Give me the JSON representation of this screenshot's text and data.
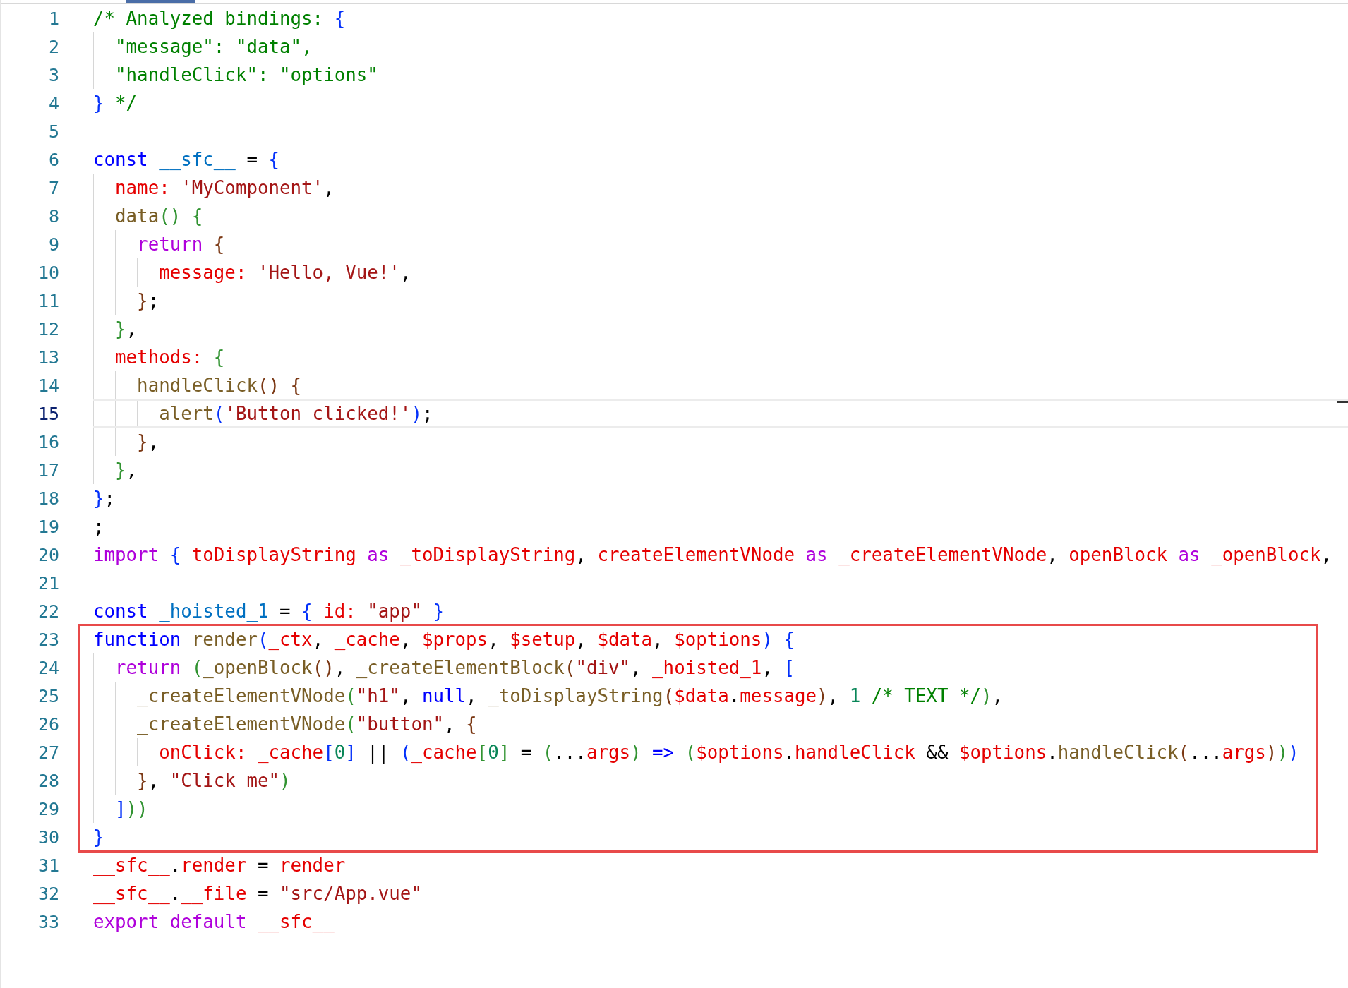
{
  "blocks": [
    {
      "boxed": false,
      "lines": [
        {
          "number": "1",
          "current": false,
          "tokens": [
            {
              "text": "/* Analyzed bindings: ",
              "kind": "comment"
            },
            {
              "text": "{",
              "kind": "b1"
            }
          ]
        },
        {
          "number": "2",
          "current": false,
          "tokens": [
            {
              "text": "  \"message\": \"data\",",
              "kind": "comment"
            }
          ]
        },
        {
          "number": "3",
          "current": false,
          "tokens": [
            {
              "text": "  \"handleClick\": \"options\"",
              "kind": "comment"
            }
          ]
        },
        {
          "number": "4",
          "current": false,
          "tokens": [
            {
              "text": "}",
              "kind": "b1"
            },
            {
              "text": " */",
              "kind": "comment"
            }
          ]
        },
        {
          "number": "5",
          "current": false
        },
        {
          "number": "6",
          "current": false,
          "tokens": [
            {
              "text": "const ",
              "kind": "keyword"
            },
            {
              "text": "__sfc__",
              "kind": "constant"
            },
            {
              "text": " = ",
              "kind": "punct"
            },
            {
              "text": "{",
              "kind": "b1"
            }
          ]
        },
        {
          "number": "7",
          "current": false,
          "tokens": [
            {
              "text": "  name: ",
              "kind": "variable"
            },
            {
              "text": "'MyComponent'",
              "kind": "string"
            },
            {
              "text": ",",
              "kind": "punct"
            }
          ]
        },
        {
          "number": "8",
          "current": false,
          "tokens": [
            {
              "text": "  data",
              "kind": "function"
            },
            {
              "text": "() {",
              "kind": "b2"
            }
          ]
        },
        {
          "number": "9",
          "current": false,
          "tokens": [
            {
              "text": "    return ",
              "kind": "control"
            },
            {
              "text": "{",
              "kind": "b3"
            }
          ]
        },
        {
          "number": "10",
          "current": false,
          "tokens": [
            {
              "text": "      message: ",
              "kind": "variable"
            },
            {
              "text": "'Hello, Vue!'",
              "kind": "string"
            },
            {
              "text": ",",
              "kind": "punct"
            }
          ]
        },
        {
          "number": "11",
          "current": false,
          "tokens": [
            {
              "text": "    }",
              "kind": "b3"
            },
            {
              "text": ";",
              "kind": "punct"
            }
          ]
        },
        {
          "number": "12",
          "current": false,
          "tokens": [
            {
              "text": "  }",
              "kind": "b2"
            },
            {
              "text": ",",
              "kind": "punct"
            }
          ]
        },
        {
          "number": "13",
          "current": false,
          "tokens": [
            {
              "text": "  methods: ",
              "kind": "variable"
            },
            {
              "text": "{",
              "kind": "b2"
            }
          ]
        },
        {
          "number": "14",
          "current": false,
          "tokens": [
            {
              "text": "    handleClick",
              "kind": "function"
            },
            {
              "text": "() {",
              "kind": "b3"
            }
          ]
        },
        {
          "number": "15",
          "current": true,
          "tokens": [
            {
              "text": "      alert",
              "kind": "function"
            },
            {
              "text": "(",
              "kind": "b1"
            },
            {
              "text": "'Button clicked!'",
              "kind": "string"
            },
            {
              "text": ")",
              "kind": "b1"
            },
            {
              "text": ";",
              "kind": "punct"
            }
          ]
        },
        {
          "number": "16",
          "current": false,
          "tokens": [
            {
              "text": "    }",
              "kind": "b3"
            },
            {
              "text": ",",
              "kind": "punct"
            }
          ]
        },
        {
          "number": "17",
          "current": false,
          "tokens": [
            {
              "text": "  }",
              "kind": "b2"
            },
            {
              "text": ",",
              "kind": "punct"
            }
          ]
        },
        {
          "number": "18",
          "current": false,
          "tokens": [
            {
              "text": "}",
              "kind": "b1"
            },
            {
              "text": ";",
              "kind": "punct"
            }
          ]
        },
        {
          "number": "19",
          "current": false,
          "tokens": [
            {
              "text": ";",
              "kind": "punct"
            }
          ]
        },
        {
          "number": "20",
          "current": false,
          "tokens": [
            {
              "text": "import ",
              "kind": "control"
            },
            {
              "text": "{ ",
              "kind": "b1"
            },
            {
              "text": "toDisplayString ",
              "kind": "variable"
            },
            {
              "text": "as ",
              "kind": "control"
            },
            {
              "text": "_toDisplayString",
              "kind": "variable"
            },
            {
              "text": ", ",
              "kind": "punct"
            },
            {
              "text": "createElementVNode ",
              "kind": "variable"
            },
            {
              "text": "as ",
              "kind": "control"
            },
            {
              "text": "_createElementVNode",
              "kind": "variable"
            },
            {
              "text": ", ",
              "kind": "punct"
            },
            {
              "text": "openBlock ",
              "kind": "variable"
            },
            {
              "text": "as ",
              "kind": "control"
            },
            {
              "text": "_openBlock",
              "kind": "variable"
            },
            {
              "text": ",",
              "kind": "punct"
            }
          ]
        },
        {
          "number": "21",
          "current": false
        },
        {
          "number": "22",
          "current": false,
          "tokens": [
            {
              "text": "const ",
              "kind": "keyword"
            },
            {
              "text": "_hoisted_1",
              "kind": "constant"
            },
            {
              "text": " = ",
              "kind": "punct"
            },
            {
              "text": "{ ",
              "kind": "b1"
            },
            {
              "text": "id: ",
              "kind": "variable"
            },
            {
              "text": "\"app\"",
              "kind": "string"
            },
            {
              "text": " }",
              "kind": "b1"
            }
          ]
        }
      ]
    },
    {
      "boxed": true,
      "lines": [
        {
          "number": "23",
          "current": false,
          "tokens": [
            {
              "text": "function ",
              "kind": "keyword"
            },
            {
              "text": "render",
              "kind": "function"
            },
            {
              "text": "(",
              "kind": "b1"
            },
            {
              "text": "_ctx",
              "kind": "variable"
            },
            {
              "text": ", ",
              "kind": "punct"
            },
            {
              "text": "_cache",
              "kind": "variable"
            },
            {
              "text": ", ",
              "kind": "punct"
            },
            {
              "text": "$props",
              "kind": "variable"
            },
            {
              "text": ", ",
              "kind": "punct"
            },
            {
              "text": "$setup",
              "kind": "variable"
            },
            {
              "text": ", ",
              "kind": "punct"
            },
            {
              "text": "$data",
              "kind": "variable"
            },
            {
              "text": ", ",
              "kind": "punct"
            },
            {
              "text": "$options",
              "kind": "variable"
            },
            {
              "text": ") {",
              "kind": "b1"
            }
          ]
        },
        {
          "number": "24",
          "current": false,
          "tokens": [
            {
              "text": "  return ",
              "kind": "control"
            },
            {
              "text": "(",
              "kind": "b2"
            },
            {
              "text": "_openBlock",
              "kind": "function"
            },
            {
              "text": "()",
              "kind": "b3"
            },
            {
              "text": ", ",
              "kind": "punct"
            },
            {
              "text": "_createElementBlock",
              "kind": "function"
            },
            {
              "text": "(",
              "kind": "b3"
            },
            {
              "text": "\"div\"",
              "kind": "string"
            },
            {
              "text": ", ",
              "kind": "punct"
            },
            {
              "text": "_hoisted_1",
              "kind": "variable"
            },
            {
              "text": ", ",
              "kind": "punct"
            },
            {
              "text": "[",
              "kind": "b1"
            }
          ]
        },
        {
          "number": "25",
          "current": false,
          "tokens": [
            {
              "text": "    _createElementVNode",
              "kind": "function"
            },
            {
              "text": "(",
              "kind": "b2"
            },
            {
              "text": "\"h1\"",
              "kind": "string"
            },
            {
              "text": ", ",
              "kind": "punct"
            },
            {
              "text": "null",
              "kind": "keyword"
            },
            {
              "text": ", ",
              "kind": "punct"
            },
            {
              "text": "_toDisplayString",
              "kind": "function"
            },
            {
              "text": "(",
              "kind": "b3"
            },
            {
              "text": "$data",
              "kind": "variable"
            },
            {
              "text": ".",
              "kind": "punct"
            },
            {
              "text": "message",
              "kind": "variable"
            },
            {
              "text": ")",
              "kind": "b3"
            },
            {
              "text": ", ",
              "kind": "punct"
            },
            {
              "text": "1 ",
              "kind": "number"
            },
            {
              "text": "/* TEXT */",
              "kind": "comment"
            },
            {
              "text": ")",
              "kind": "b2"
            },
            {
              "text": ",",
              "kind": "punct"
            }
          ]
        },
        {
          "number": "26",
          "current": false,
          "tokens": [
            {
              "text": "    _createElementVNode",
              "kind": "function"
            },
            {
              "text": "(",
              "kind": "b2"
            },
            {
              "text": "\"button\"",
              "kind": "string"
            },
            {
              "text": ", ",
              "kind": "punct"
            },
            {
              "text": "{",
              "kind": "b3"
            }
          ]
        },
        {
          "number": "27",
          "current": false,
          "tokens": [
            {
              "text": "      onClick: _cache",
              "kind": "variable"
            },
            {
              "text": "[",
              "kind": "b1"
            },
            {
              "text": "0",
              "kind": "number"
            },
            {
              "text": "]",
              "kind": "b1"
            },
            {
              "text": " || ",
              "kind": "punct"
            },
            {
              "text": "(",
              "kind": "b1"
            },
            {
              "text": "_cache",
              "kind": "variable"
            },
            {
              "text": "[",
              "kind": "b2"
            },
            {
              "text": "0",
              "kind": "number"
            },
            {
              "text": "]",
              "kind": "b2"
            },
            {
              "text": " = ",
              "kind": "punct"
            },
            {
              "text": "(",
              "kind": "b2"
            },
            {
              "text": "...",
              "kind": "punct"
            },
            {
              "text": "args",
              "kind": "variable"
            },
            {
              "text": ")",
              "kind": "b2"
            },
            {
              "text": " => ",
              "kind": "keyword"
            },
            {
              "text": "(",
              "kind": "b2"
            },
            {
              "text": "$options",
              "kind": "variable"
            },
            {
              "text": ".",
              "kind": "punct"
            },
            {
              "text": "handleClick",
              "kind": "variable"
            },
            {
              "text": " && ",
              "kind": "punct"
            },
            {
              "text": "$options",
              "kind": "variable"
            },
            {
              "text": ".",
              "kind": "punct"
            },
            {
              "text": "handleClick",
              "kind": "function"
            },
            {
              "text": "(",
              "kind": "b3"
            },
            {
              "text": "...",
              "kind": "punct"
            },
            {
              "text": "args",
              "kind": "variable"
            },
            {
              "text": ")",
              "kind": "b3"
            },
            {
              "text": ")",
              "kind": "b2"
            },
            {
              "text": ")",
              "kind": "b1"
            }
          ]
        },
        {
          "number": "28",
          "current": false,
          "tokens": [
            {
              "text": "    }",
              "kind": "b3"
            },
            {
              "text": ", ",
              "kind": "punct"
            },
            {
              "text": "\"Click me\"",
              "kind": "string"
            },
            {
              "text": ")",
              "kind": "b2"
            }
          ]
        },
        {
          "number": "29",
          "current": false,
          "tokens": [
            {
              "text": "  ]",
              "kind": "b1"
            },
            {
              "text": "))",
              "kind": "b2"
            }
          ]
        },
        {
          "number": "30",
          "current": false,
          "tokens": [
            {
              "text": "}",
              "kind": "b1"
            }
          ]
        }
      ]
    },
    {
      "boxed": false,
      "lines": [
        {
          "number": "31",
          "current": false,
          "tokens": [
            {
              "text": "__sfc__",
              "kind": "variable"
            },
            {
              "text": ".",
              "kind": "punct"
            },
            {
              "text": "render",
              "kind": "variable"
            },
            {
              "text": " = ",
              "kind": "punct"
            },
            {
              "text": "render",
              "kind": "variable"
            }
          ]
        },
        {
          "number": "32",
          "current": false,
          "tokens": [
            {
              "text": "__sfc__",
              "kind": "variable"
            },
            {
              "text": ".",
              "kind": "punct"
            },
            {
              "text": "__file",
              "kind": "variable"
            },
            {
              "text": " = ",
              "kind": "punct"
            },
            {
              "text": "\"src/App.vue\"",
              "kind": "string"
            }
          ]
        },
        {
          "number": "33",
          "current": false,
          "tokens": [
            {
              "text": "export default ",
              "kind": "control"
            },
            {
              "text": "__sfc__",
              "kind": "variable"
            }
          ]
        }
      ]
    }
  ]
}
